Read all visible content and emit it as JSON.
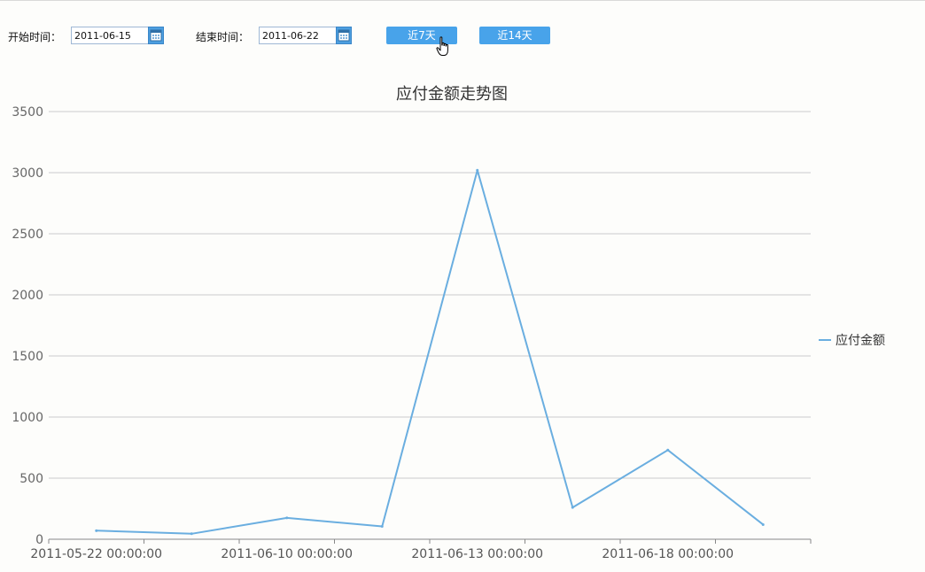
{
  "filters": {
    "start_label": "开始时间：",
    "start_value": "2011-06-15",
    "end_label": "结束时间：",
    "end_value": "2011-06-22",
    "btn_7": "近7天",
    "btn_14": "近14天"
  },
  "chart_data": {
    "type": "line",
    "title": "应付金额走势图",
    "xlabel": "",
    "ylabel": "",
    "x_tick_labels": [
      "2011-05-22 00:00:00",
      "2011-06-10 00:00:00",
      "2011-06-13 00:00:00",
      "2011-06-18 00:00:00"
    ],
    "ylim": [
      0,
      3500
    ],
    "yticks": [
      0,
      500,
      1000,
      1500,
      2000,
      2500,
      3000,
      3500
    ],
    "grid": true,
    "legend_position": "right",
    "series": [
      {
        "name": "应付金额",
        "color": "#6aaee0",
        "values": [
          70,
          45,
          175,
          105,
          3020,
          260,
          730,
          120
        ]
      }
    ]
  }
}
